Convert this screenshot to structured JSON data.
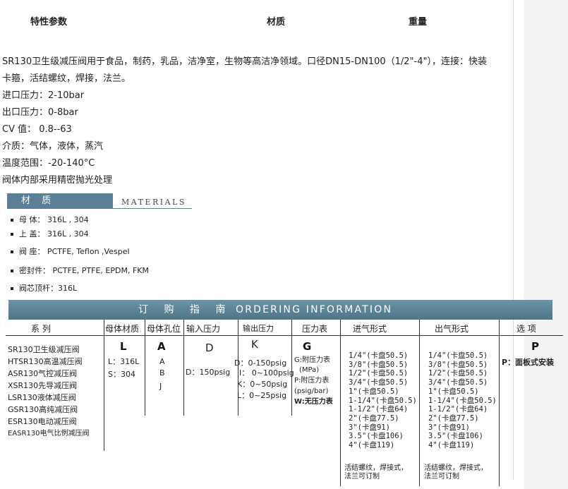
{
  "header": {
    "col1": "特性参数",
    "col2": "材质",
    "col3": "重量"
  },
  "description": {
    "line1": "SR130卫生级减压阀用于食品，制药，乳品，洁净室，生物等高洁净领域。口径DN15-DN100（1/2\"-4\"），连接：快装",
    "line2": "卡箍，活结螺纹，焊接，法兰。",
    "specs": [
      "进口压力：2-10bar",
      "出口压力：0-8bar",
      "CV 值：    0.8--63",
      "介质：气体，液体，蒸汽",
      "温度范围：-20-140°C",
      "阀体内部采用精密抛光处理"
    ]
  },
  "materials": {
    "title_cn": "材  质",
    "title_en": "MATERIALS",
    "items": [
      "母   体：  316L , 304",
      "上   盖：  316L , 304",
      "阀   座：  PCTFE,  Teflon  ,Vespel",
      "密封件：  PCTFE, PTFE, EPDM, FKM",
      "阀芯顶杆：316L"
    ]
  },
  "ordering": {
    "title_cn": "订 购 指 南",
    "title_en": "ORDERING   INFORMATION",
    "headers": [
      "系  列",
      "母体材质",
      "母体孔位",
      "输入压力",
      "输出压力",
      "压力表",
      "进气形式",
      "出气形式",
      "选  项"
    ],
    "series": [
      "SR130卫生级减压阀",
      "HTSR130高温减压阀",
      "ASR130气控减压阀",
      "XSR130先导减压阀",
      "LSR130液体减压阀",
      "GSR130高纯减压阀",
      "ESR130电动减压阀",
      "EASR130电气比例减压阀"
    ],
    "body_material": {
      "code": "L",
      "options": [
        "L：316L",
        "S：304"
      ]
    },
    "port": {
      "code": "A",
      "options": [
        "A",
        "B",
        "J"
      ]
    },
    "inlet_pressure": {
      "code": "D",
      "options": [
        "D：150psig"
      ]
    },
    "outlet_pressure": {
      "code": "K",
      "options": [
        "D：0-150psig",
        "I： 0~100psig",
        "K：0~50psig",
        "L：0~25psig"
      ]
    },
    "gauge": {
      "code": "G",
      "options": [
        "G:附压力表",
        "(MPa)",
        "P:附压力表",
        "(psig/bar)",
        "W:无压力表"
      ]
    },
    "inlet_form": {
      "options": [
        "1/4\"(卡盘50.5)",
        "3/8\"(卡盘50.5)",
        "1/2\"(卡盘50.5)",
        "3/4\"(卡盘50.5)",
        "1\"(卡盘50.5)",
        "1-1/4\"(卡盘50.5)",
        "1-1/2\"(卡盘64)",
        "2\"(卡盘77.5)",
        "3\"(卡盘91)",
        "3.5\"(卡盘106)",
        "4\"(卡盘119)"
      ],
      "note1": "活结螺纹，焊接式，",
      "note2": "法兰可订制"
    },
    "outlet_form": {
      "options": [
        "1/4\"(卡盘50.5)",
        "3/8\"(卡盘50.5)",
        "1/2\"(卡盘50.5)",
        "3/4\"(卡盘50.5)",
        "1\"(卡盘50.5)",
        "1-1/4\"(卡盘50.5)",
        "1-1/2\"(卡盘64)",
        "2\"(卡盘77.5)",
        "3\"(卡盘91)",
        "3.5\"(卡盘106)",
        "4\"(卡盘119)"
      ],
      "note1": "活结螺纹，焊接式，",
      "note2": "法兰可订制"
    },
    "option": {
      "code": "P",
      "text": "P：面板式安装"
    }
  }
}
